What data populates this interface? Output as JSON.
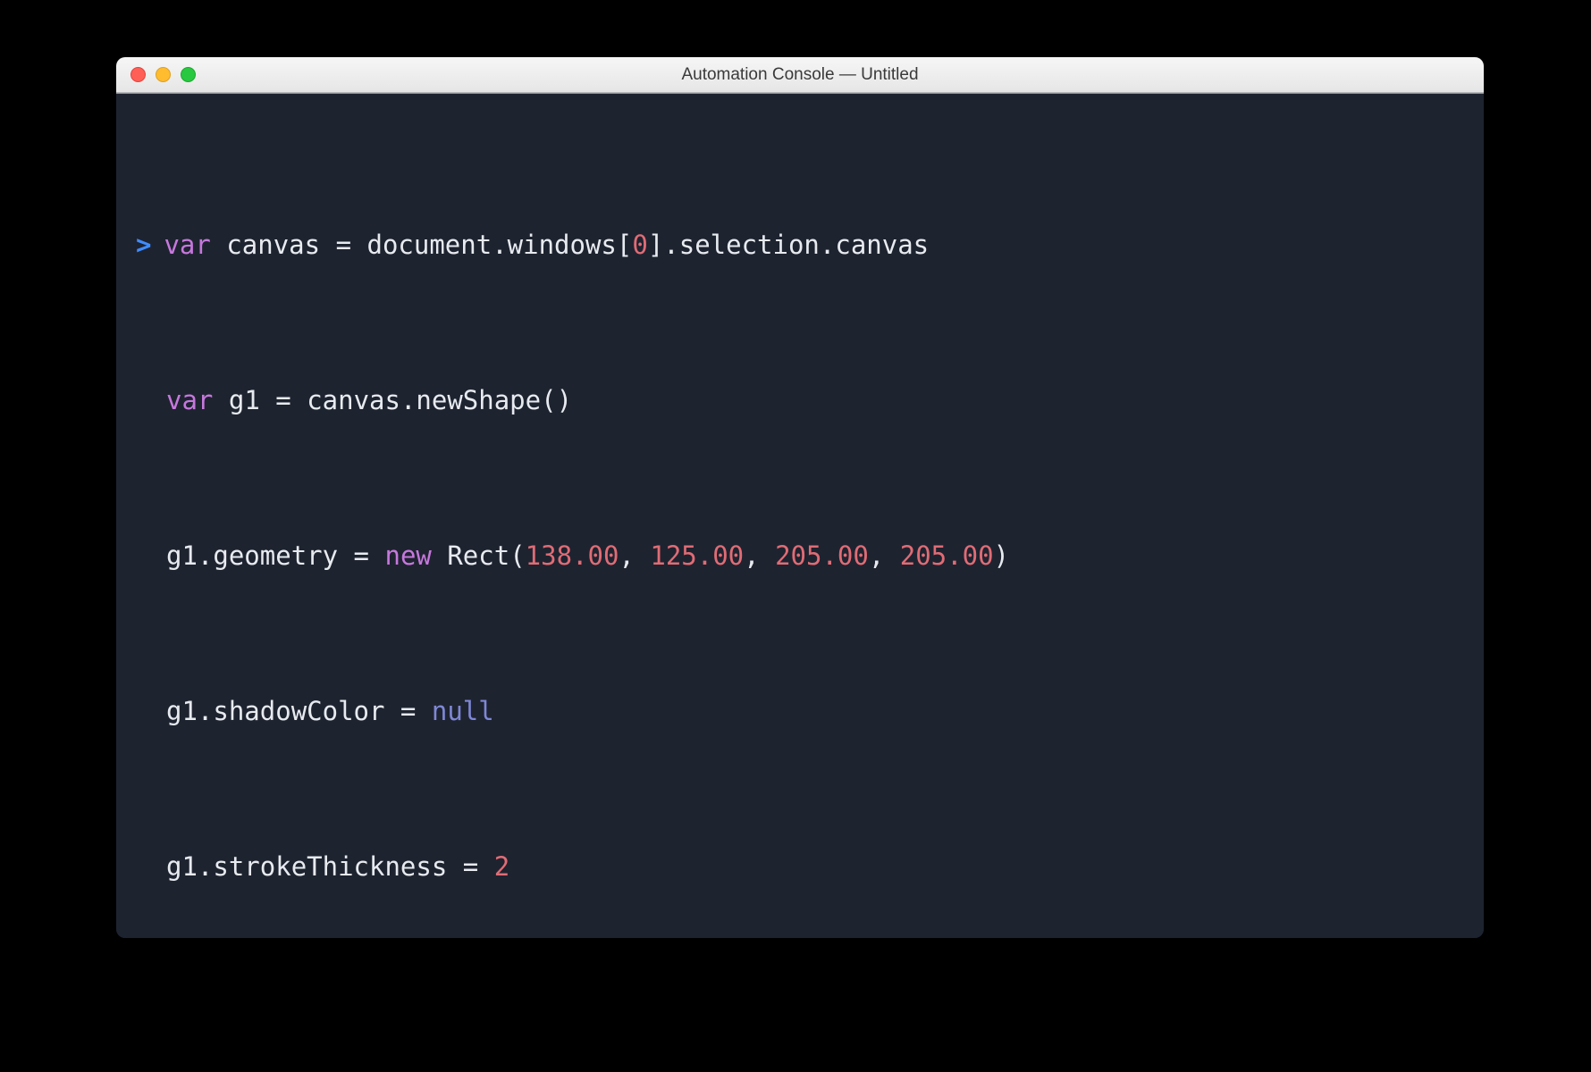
{
  "window": {
    "title": "Automation Console — Untitled"
  },
  "prompt": ">",
  "code": {
    "line1": {
      "kw_var": "var",
      "sp1": " ",
      "canvas": "canvas",
      "sp2": " ",
      "eq": "=",
      "sp3": " ",
      "document": "document",
      "dot1": ".",
      "windows": "windows",
      "lbrack": "[",
      "idx": "0",
      "rbrack": "]",
      "dot2": ".",
      "selection": "selection",
      "dot3": ".",
      "canvas2": "canvas"
    },
    "line2": {
      "kw_var": "var",
      "sp1": " ",
      "g1": "g1",
      "sp2": " ",
      "eq": "=",
      "sp3": " ",
      "canvas": "canvas",
      "dot": ".",
      "newShape": "newShape",
      "lparen": "(",
      "rparen": ")"
    },
    "line3": {
      "g1": "g1",
      "dot": ".",
      "geometry": "geometry",
      "sp1": " ",
      "eq": "=",
      "sp2": " ",
      "kw_new": "new",
      "sp3": " ",
      "Rect": "Rect",
      "lparen": "(",
      "n1": "138.00",
      "c1": ",",
      "sp4": " ",
      "n2": "125.00",
      "c2": ",",
      "sp5": " ",
      "n3": "205.00",
      "c3": ",",
      "sp6": " ",
      "n4": "205.00",
      "rparen": ")"
    },
    "line4": {
      "g1": "g1",
      "dot": ".",
      "shadowColor": "shadowColor",
      "sp1": " ",
      "eq": "=",
      "sp2": " ",
      "null": "null"
    },
    "line5": {
      "g1": "g1",
      "dot": ".",
      "strokeThickness": "strokeThickness",
      "sp1": " ",
      "eq": "=",
      "sp2": " ",
      "n": "2"
    }
  },
  "colors": {
    "bg": "#1e2330",
    "keyword": "#c678dd",
    "number": "#e06c75",
    "null": "#7f88d6",
    "text": "#e7ebf0",
    "prompt": "#3f8cff"
  }
}
